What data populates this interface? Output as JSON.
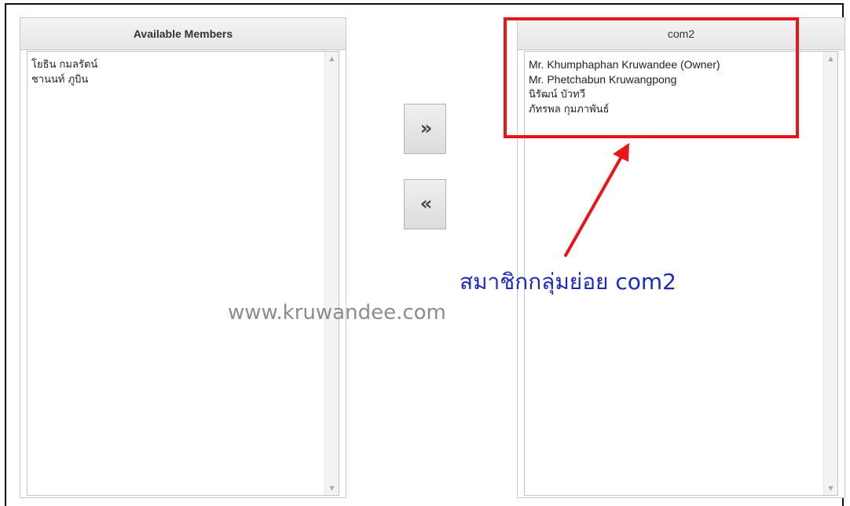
{
  "left_panel": {
    "title": "Available Members",
    "items": [
      "โยธิน กมลรัตน์",
      "ชานนท์ ภูบิน"
    ]
  },
  "right_panel": {
    "title": "com2",
    "items": [
      "Mr. Khumphaphan Kruwandee (Owner)",
      "Mr. Phetchabun Kruwangpong",
      "นิรัฒน์ บัวทวี",
      "ภัทรพล กุมภาพันธ์"
    ]
  },
  "buttons": {
    "add_label": "»",
    "remove_label": "«"
  },
  "watermark": "www.kruwandee.com",
  "annotation": {
    "text": "สมาชิกกลุ่มย่อย com2",
    "highlight_color": "#e8161b",
    "text_color": "#1d2bbd"
  }
}
